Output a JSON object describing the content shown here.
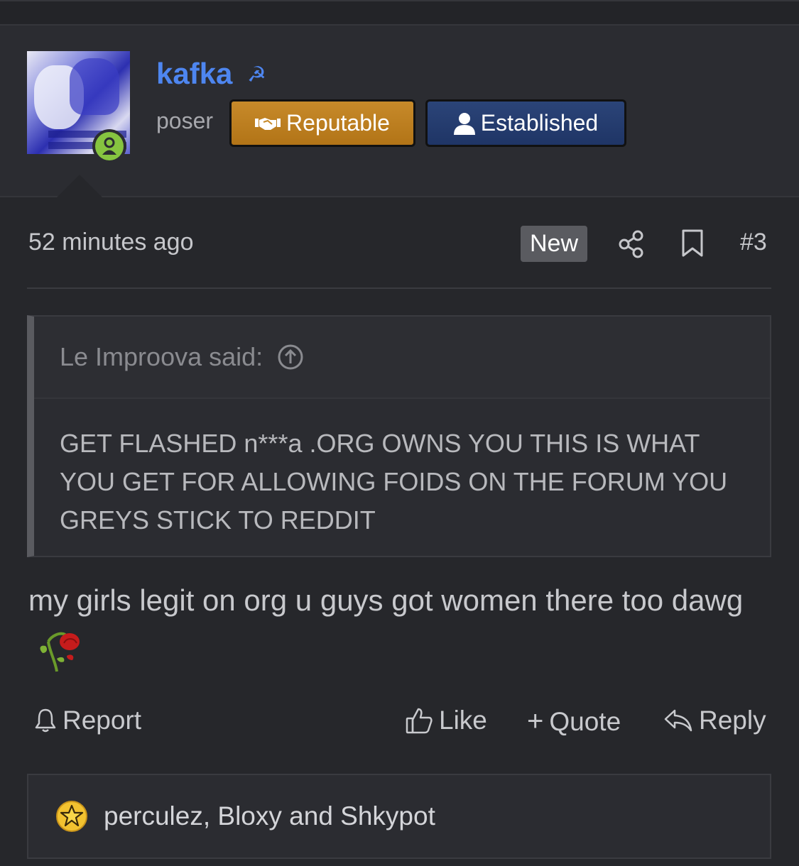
{
  "post": {
    "username": "kafka",
    "user_title": "poser",
    "badges": {
      "reputable": "Reputable",
      "established": "Established"
    },
    "time": "52 minutes ago",
    "new_label": "New",
    "post_number": "#3",
    "quote": {
      "attribution": "Le Improova said:",
      "text": "GET FLASHED n***a .ORG OWNS YOU THIS IS WHAT YOU GET FOR ALLOWING FOIDS ON THE FORUM YOU GREYS STICK TO REDDIT"
    },
    "message": "my girls legit on org u guys got women there too dawg"
  },
  "actions": {
    "report": "Report",
    "like": "Like",
    "quote": "Quote",
    "reply": "Reply"
  },
  "reactions": {
    "users": "perculez, Bloxy and Shkypot"
  },
  "colors": {
    "username": "#4e86f0",
    "reputable_badge": "#c78a2a",
    "established_badge": "#2b4478",
    "online": "#86c440"
  }
}
